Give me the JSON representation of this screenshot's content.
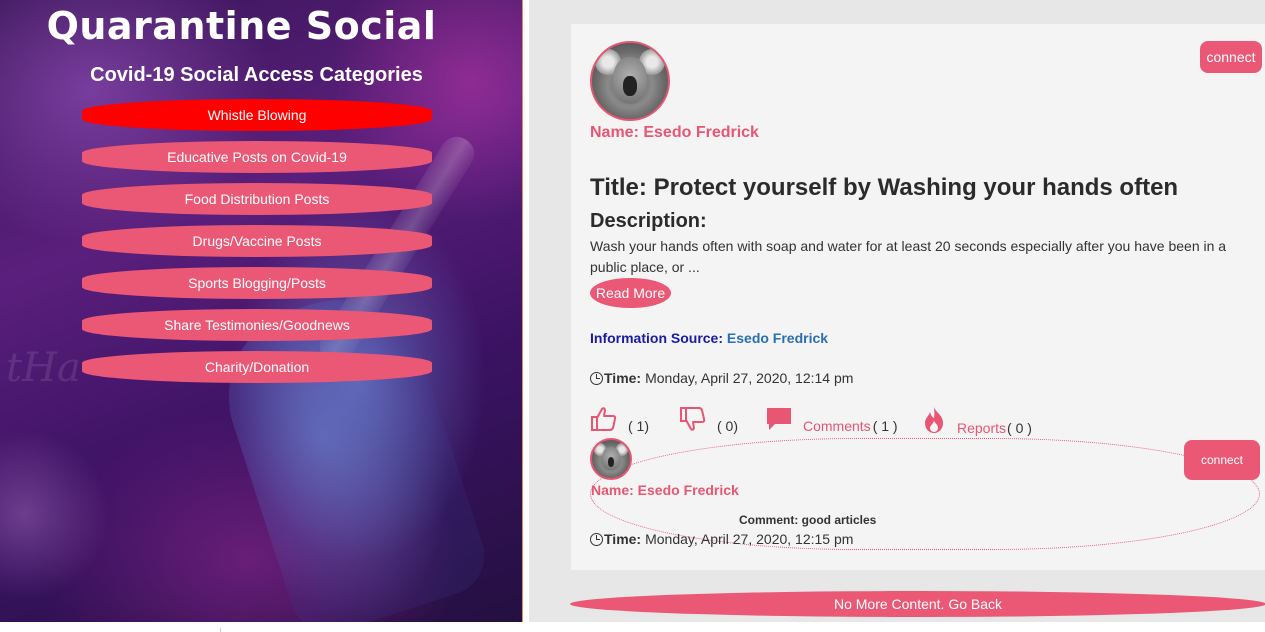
{
  "app": {
    "title": "Quarantine Social"
  },
  "sidebar": {
    "heading": "Covid-19 Social Access Categories",
    "items": [
      {
        "label": "Whistle Blowing",
        "active": true
      },
      {
        "label": "Educative Posts on Covid-19"
      },
      {
        "label": "Food Distribution Posts"
      },
      {
        "label": "Drugs/Vaccine Posts"
      },
      {
        "label": "Sports Blogging/Posts"
      },
      {
        "label": "Share Testimonies/Goodnews"
      },
      {
        "label": "Charity/Donation"
      }
    ]
  },
  "post": {
    "connect_label": "connect",
    "name": "Name: Esedo Fredrick",
    "title": "Title: Protect yourself by Washing your hands often",
    "description_label": "Description:",
    "description": "Wash your hands often with soap and water for at least 20 seconds especially after you have been in a public place, or ...",
    "read_more": "Read More",
    "info_source_label": "Information Source:",
    "info_source_value": "Esedo Fredrick",
    "time_label": "Time:",
    "time_value": "Monday, April 27, 2020, 12:14 pm",
    "likes": "( 1)",
    "dislikes": "( 0)",
    "comments_label": "Comments",
    "comments_count": "( 1 )",
    "reports_label": "Reports",
    "reports_count": "( 0 )"
  },
  "comment": {
    "connect_label": "connect",
    "name": "Name: Esedo Fredrick",
    "text": "Comment: good articles",
    "time_label": "Time:",
    "time_value": "Monday, April 27, 2020, 12:15 pm"
  },
  "footer": {
    "no_more": "No More Content. Go Back"
  },
  "colors": {
    "accent": "#ea5875",
    "active": "#ff0000",
    "link_blue": "#2a6fb3"
  },
  "icons": [
    "thumbs-up-icon",
    "thumbs-down-icon",
    "comment-icon",
    "fire-icon",
    "clock-icon",
    "koala-avatar"
  ]
}
